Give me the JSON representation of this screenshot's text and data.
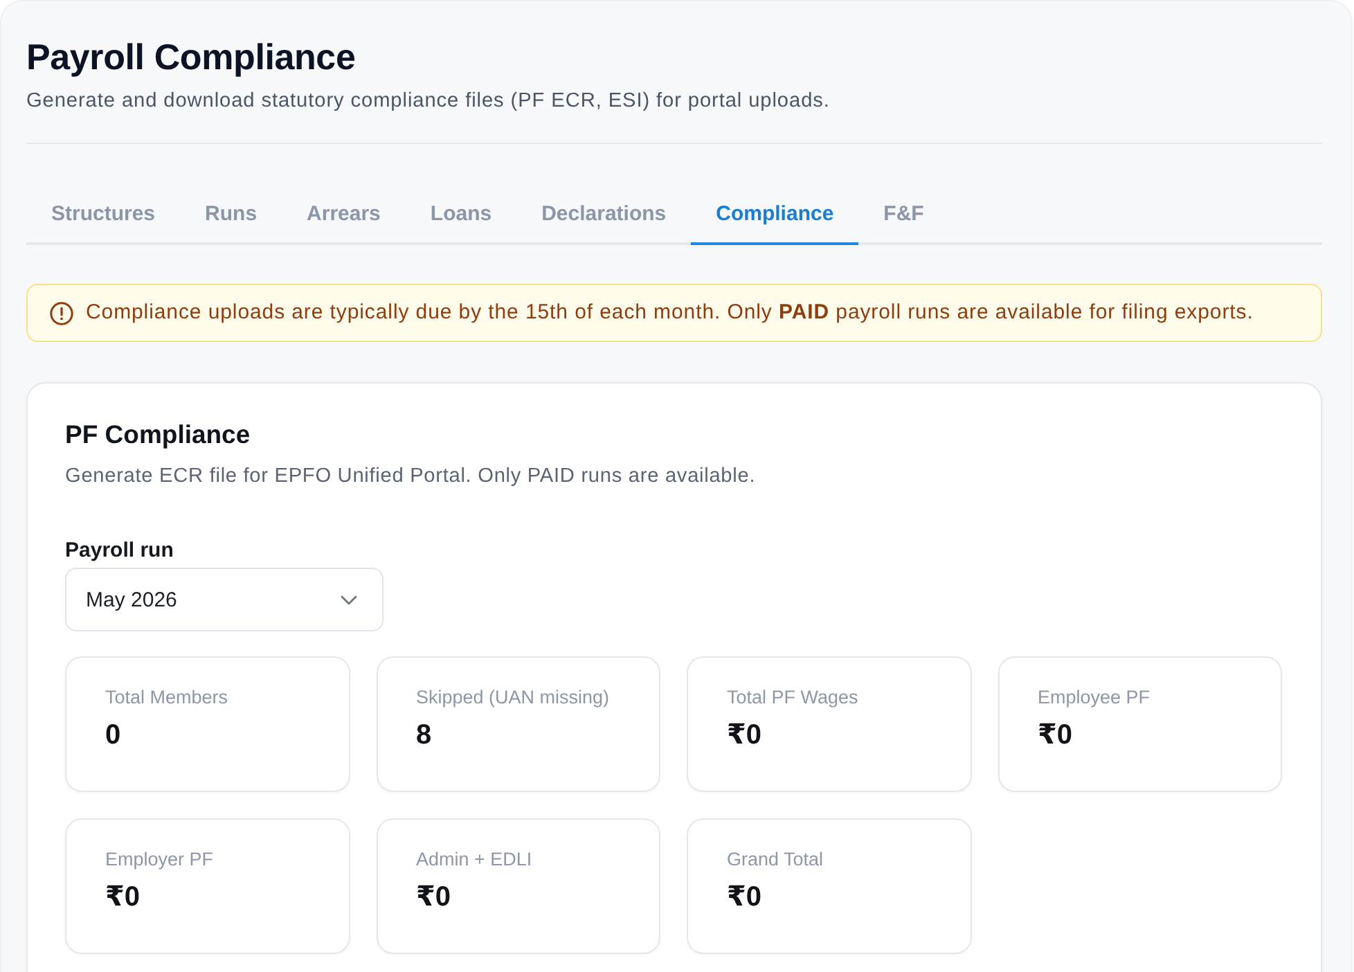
{
  "header": {
    "title": "Payroll Compliance",
    "subtitle": "Generate and download statutory compliance files (PF ECR, ESI) for portal uploads."
  },
  "tabs": [
    {
      "label": "Structures",
      "selected": false
    },
    {
      "label": "Runs",
      "selected": false
    },
    {
      "label": "Arrears",
      "selected": false
    },
    {
      "label": "Loans",
      "selected": false
    },
    {
      "label": "Declarations",
      "selected": false
    },
    {
      "label": "Compliance",
      "selected": true
    },
    {
      "label": "F&F",
      "selected": false
    }
  ],
  "alert": {
    "kind": "warning",
    "text": "Compliance uploads are typically due by the 15th of each month. Only **PAID** payroll runs are available for filing exports."
  },
  "pf_card": {
    "title": "PF Compliance",
    "description": "Generate ECR file for EPFO Unified Portal. Only PAID runs are available.",
    "payroll_run": {
      "label": "Payroll run",
      "value": "May 2026"
    },
    "stats": [
      {
        "label": "Total Members",
        "value": "0"
      },
      {
        "label": "Skipped (UAN missing)",
        "value": "8"
      },
      {
        "label": "Total PF Wages",
        "value": "₹0"
      },
      {
        "label": "Employee PF",
        "value": "₹0"
      },
      {
        "label": "Employer PF",
        "value": "₹0"
      },
      {
        "label": "Admin + EDLI",
        "value": "₹0"
      },
      {
        "label": "Grand Total",
        "value": "₹0"
      }
    ]
  }
}
